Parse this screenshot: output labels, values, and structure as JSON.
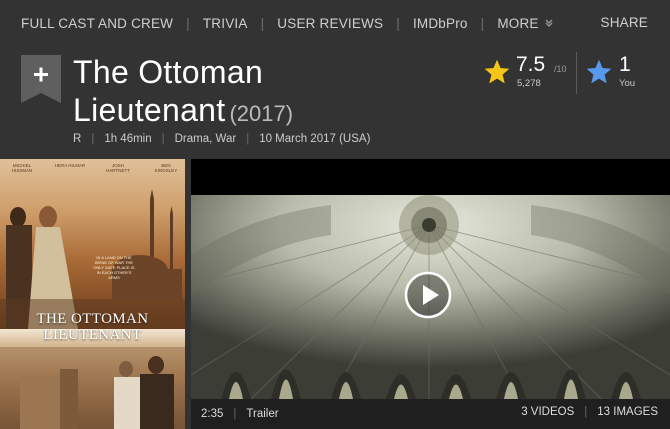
{
  "nav": {
    "full_cast": "FULL CAST AND CREW",
    "trivia": "TRIVIA",
    "reviews": "USER REVIEWS",
    "imdbpro": "IMDbPro",
    "more": "MORE",
    "share": "SHARE"
  },
  "title": {
    "name_line1": "The Ottoman",
    "name_line2": "Lieutenant",
    "year": "(2017)"
  },
  "meta": {
    "certificate": "R",
    "runtime": "1h 46min",
    "genres": "Drama, War",
    "release": "10 March 2017 (USA)"
  },
  "rating": {
    "score": "7.5",
    "out_of": "/10",
    "count": "5,278",
    "star_color": "#f5c518"
  },
  "user_rating": {
    "value": "1",
    "label": "You",
    "star_color": "#5799ef"
  },
  "poster": {
    "credits": [
      "MICHIEL HUISMAN",
      "HERA HILMAR",
      "JOSH HARTNETT",
      "BEN KINGSLEY"
    ],
    "tagline": "IN A LAND ON THE BRINK OF WAR THE ONLY SAFE PLACE IS IN EACH OTHER'S ARMS",
    "title_line1": "THE OTTOMAN",
    "title_line2": "LIEUTENANT"
  },
  "video": {
    "duration": "2:35",
    "type": "Trailer",
    "videos_count": "3 VIDEOS",
    "images_count": "13 IMAGES"
  },
  "colors": {
    "background": "#333333",
    "video_bar": "#1f1f1f"
  }
}
